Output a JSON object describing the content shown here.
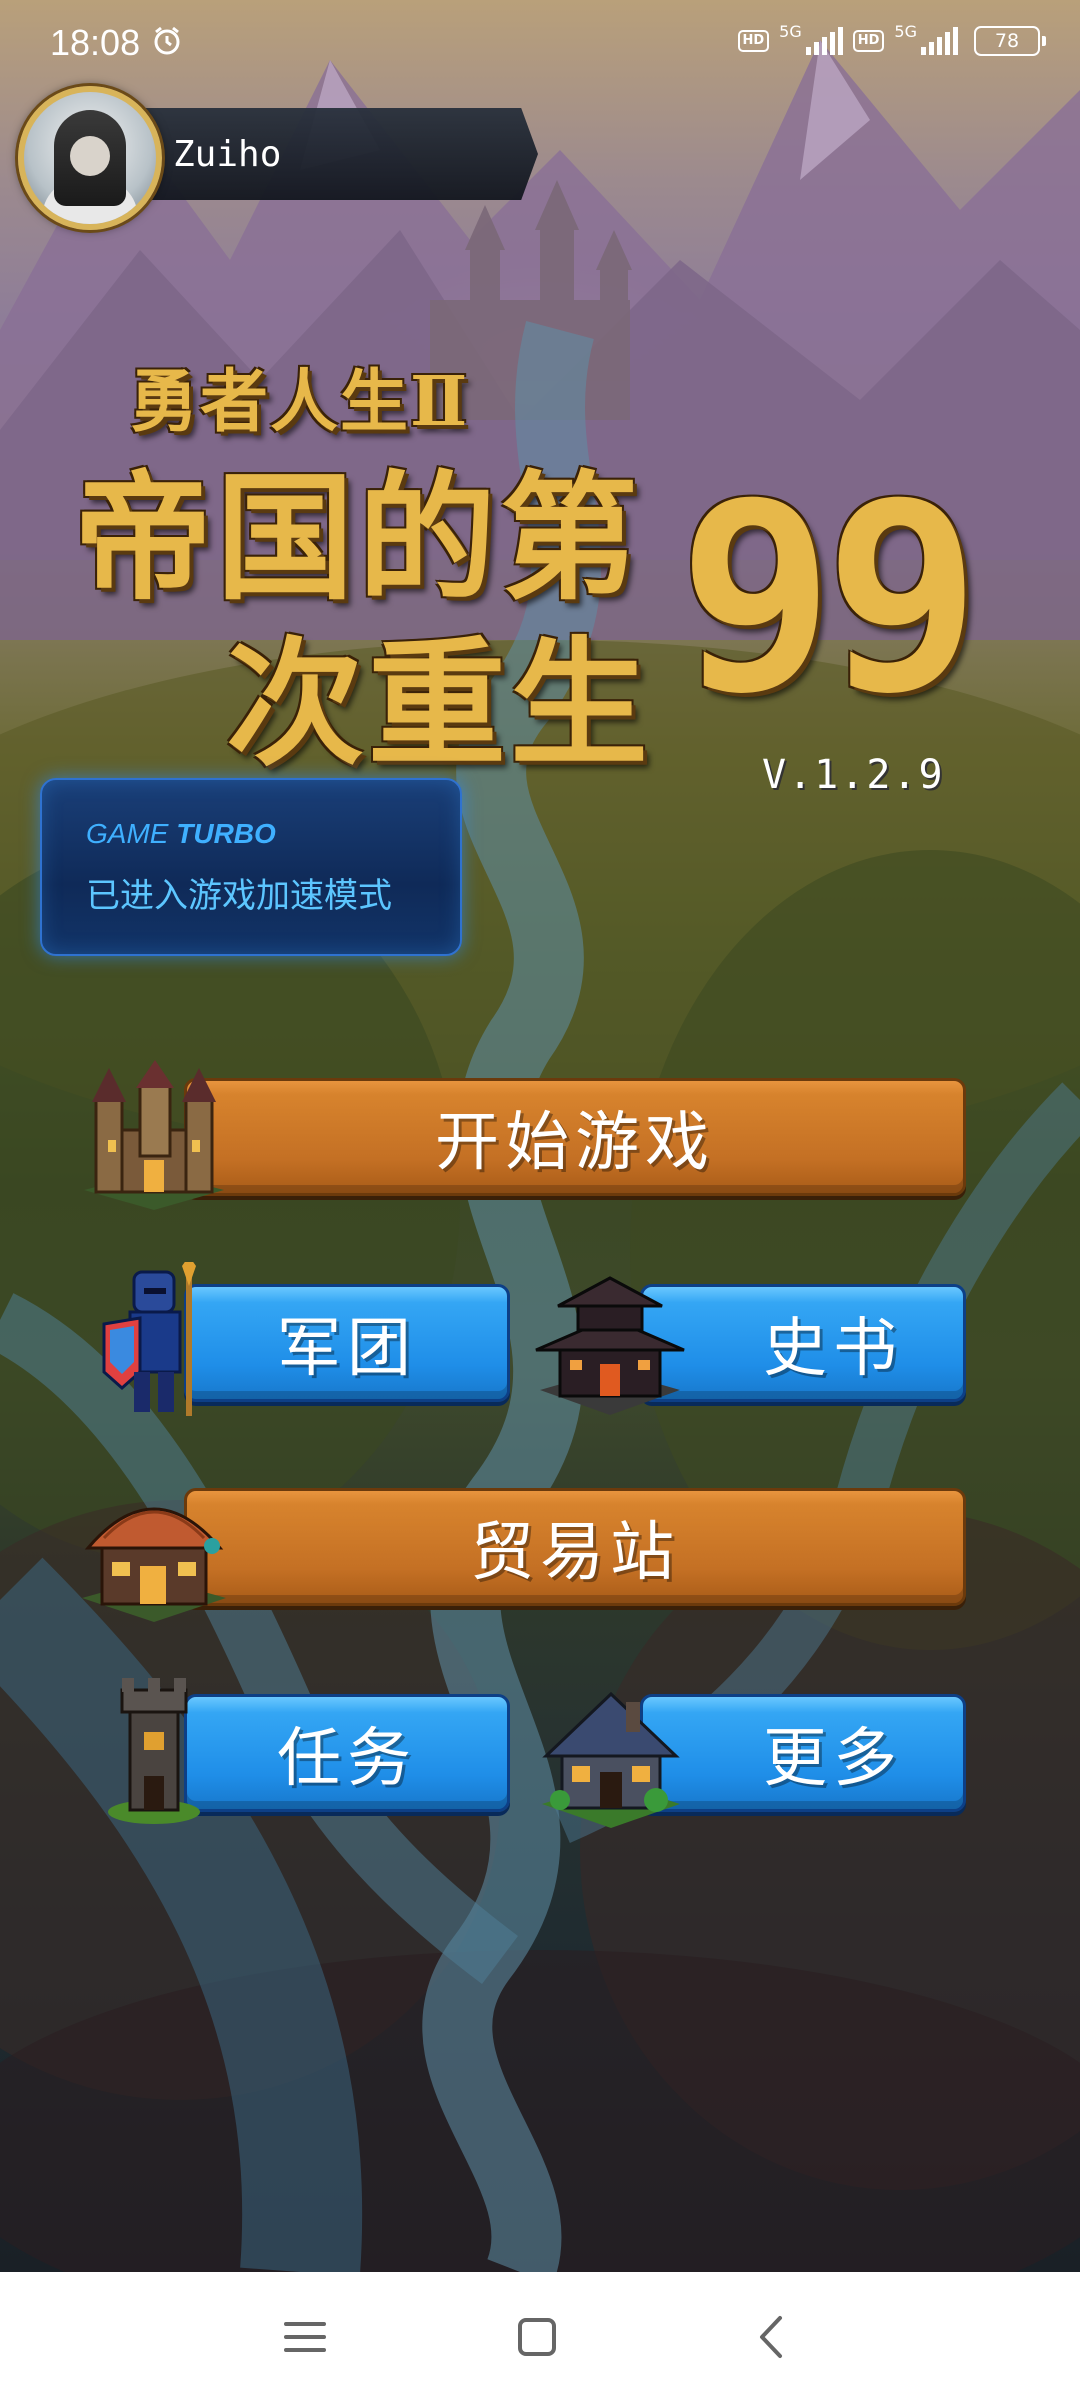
{
  "status_bar": {
    "time": "18:08",
    "hd1": "HD",
    "net1": "5G",
    "hd2": "HD",
    "net2": "5G",
    "battery": "78"
  },
  "player": {
    "name": "Zuiho"
  },
  "title": {
    "subtitle": "勇者人生Ⅱ",
    "line1": "帝国的第",
    "line2": "次重生",
    "number": "99",
    "version": "V.1.2.9"
  },
  "turbo": {
    "brand_prefix": "GAME",
    "brand_suffix": "TURBO",
    "message": "已进入游戏加速模式"
  },
  "menu": {
    "start": "开始游戏",
    "legion": "军团",
    "history": "史书",
    "trade": "贸易站",
    "tasks": "任务",
    "more": "更多"
  },
  "colors": {
    "orange_button": "#c47024",
    "blue_button": "#1f8ee8",
    "title_gold": "#e7b84a"
  }
}
